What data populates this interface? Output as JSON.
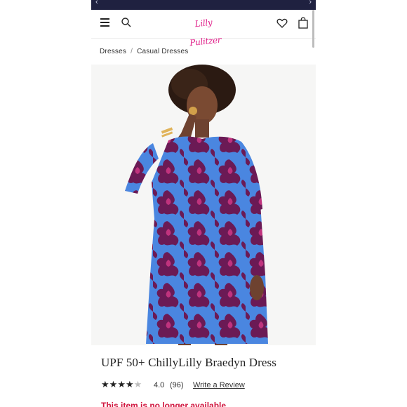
{
  "breadcrumb": {
    "items": [
      "Dresses",
      "Casual Dresses"
    ],
    "separator": "/"
  },
  "header": {
    "logo_text": "Lilly Pulitzer",
    "icons": [
      "menu-icon",
      "search-icon",
      "heart-icon",
      "shopping-bag-icon"
    ]
  },
  "product": {
    "title": "UPF 50+ ChillyLilly Braedyn Dress",
    "rating_value": "4.0",
    "review_count": "(96)",
    "stars_filled": 4,
    "stars_total": 5,
    "write_review_label": "Write a Review",
    "availability_text": "This item is no longer available"
  },
  "colors": {
    "promo_bar": "#1f2140",
    "brand_pink": "#e0218a",
    "alert_red": "#d0153e",
    "dress_blue": "#4a86e0",
    "dress_plum": "#6b1a55"
  }
}
